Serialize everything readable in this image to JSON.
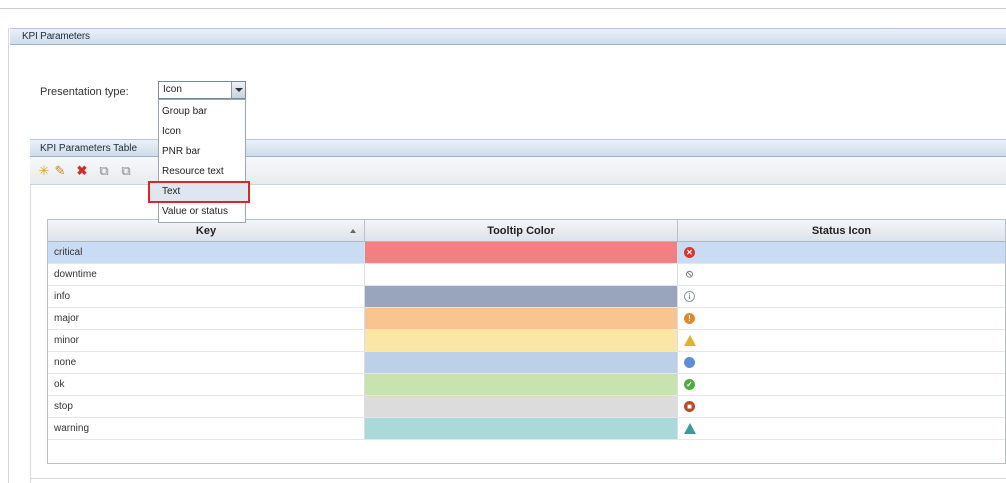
{
  "kpi_parameters": {
    "title": "KPI Parameters"
  },
  "presentation": {
    "label": "Presentation type:",
    "selected": "Icon",
    "options": [
      "Group bar",
      "Icon",
      "PNR bar",
      "Resource text",
      "Text",
      "Value or status"
    ],
    "highlighted_option": "Text"
  },
  "table_panel": {
    "title": "KPI Parameters Table"
  },
  "toolbar": {
    "icons": [
      "new-icon",
      "edit-icon",
      "delete-icon",
      "copy-icon",
      "paste-icon"
    ]
  },
  "grid": {
    "columns": [
      "Key",
      "Tooltip Color",
      "Status Icon"
    ],
    "rows": [
      {
        "key": "critical",
        "color": "#f47f82",
        "icon": "critical-icon",
        "icon_color": "#d9362f"
      },
      {
        "key": "downtime",
        "color": "#ffffff",
        "icon": "downtime-icon",
        "icon_color": "#7a7a7a"
      },
      {
        "key": "info",
        "color": "#98a5bd",
        "icon": "info-icon",
        "icon_color": "#8c95a3"
      },
      {
        "key": "major",
        "color": "#f8c490",
        "icon": "major-icon",
        "icon_color": "#e0892c"
      },
      {
        "key": "minor",
        "color": "#fbe6a5",
        "icon": "minor-icon",
        "icon_color": "#e1b12a"
      },
      {
        "key": "none",
        "color": "#bdd0ea",
        "icon": "none-icon",
        "icon_color": "#5c8fd6"
      },
      {
        "key": "ok",
        "color": "#c9e3b0",
        "icon": "ok-icon",
        "icon_color": "#4fae3b"
      },
      {
        "key": "stop",
        "color": "#dcdcdc",
        "icon": "stop-icon",
        "icon_color": "#b84a2a"
      },
      {
        "key": "warning",
        "color": "#a9dad7",
        "icon": "warning-icon",
        "icon_color": "#3f9a96"
      }
    ],
    "selected_row": "critical"
  }
}
